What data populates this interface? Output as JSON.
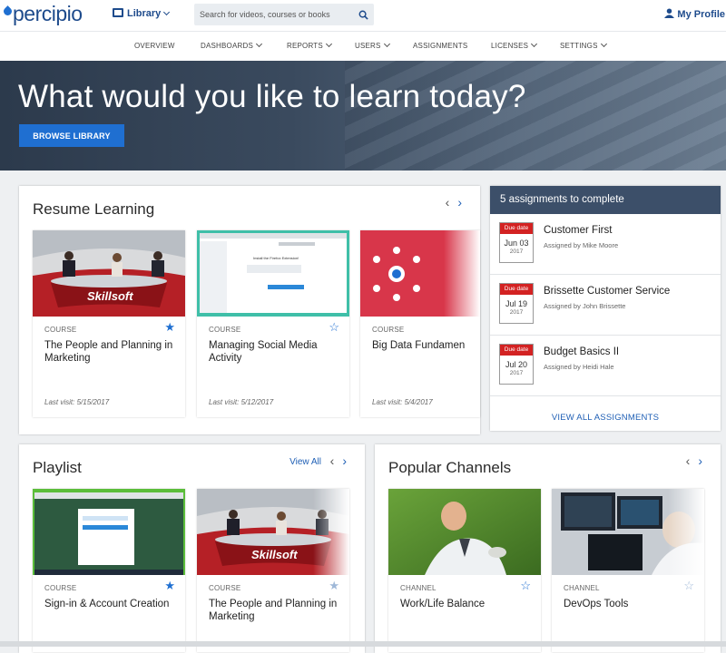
{
  "header": {
    "logo": "percipio",
    "library_label": "Library",
    "search_placeholder": "Search for videos, courses or books",
    "profile_label": "My Profile"
  },
  "nav": [
    "OVERVIEW",
    "DASHBOARDS",
    "REPORTS",
    "USERS",
    "ASSIGNMENTS",
    "LICENSES",
    "SETTINGS"
  ],
  "hero": {
    "title": "What would you like to learn today?",
    "button": "BROWSE LIBRARY"
  },
  "resume": {
    "title": "Resume Learning",
    "items": [
      {
        "kind": "COURSE",
        "title": "The People and Planning in Marketing",
        "visit": "Last visit: 5/15/2017",
        "starred": true,
        "brand": "Skillsoft"
      },
      {
        "kind": "COURSE",
        "title": "Managing Social Media Activity",
        "visit": "Last visit: 5/12/2017",
        "starred": false,
        "screen_text": "Install the Firefox Extension!"
      },
      {
        "kind": "COURSE",
        "title": "Big Data Fundamen",
        "visit": "Last visit: 5/4/2017",
        "starred": false
      }
    ]
  },
  "assignments": {
    "header": "5 assignments to complete",
    "due_label": "Due date",
    "items": [
      {
        "date": "Jun 03",
        "year": "2017",
        "title": "Customer First",
        "by": "Assigned by Mike Moore"
      },
      {
        "date": "Jul 19",
        "year": "2017",
        "title": "Brissette Customer Service",
        "by": "Assigned by John Brissette"
      },
      {
        "date": "Jul 20",
        "year": "2017",
        "title": "Budget Basics II",
        "by": "Assigned by Heidi Hale"
      }
    ],
    "view_all": "VIEW ALL ASSIGNMENTS"
  },
  "playlist": {
    "title": "Playlist",
    "view_all": "View All",
    "items": [
      {
        "kind": "COURSE",
        "title": "Sign-in & Account Creation",
        "starred": true
      },
      {
        "kind": "COURSE",
        "title": "The People and Planning in Marketing",
        "starred": false,
        "brand": "Skillsoft"
      }
    ]
  },
  "channels": {
    "title": "Popular Channels",
    "items": [
      {
        "kind": "CHANNEL",
        "title": "Work/Life Balance",
        "starred": false
      },
      {
        "kind": "CHANNEL",
        "title": "DevOps Tools",
        "starred": false
      }
    ]
  },
  "colors": {
    "accent": "#1f6fd1",
    "hero_dark": "#2c3a4c",
    "due_red": "#d32222",
    "assign_header": "#3c4f69"
  }
}
